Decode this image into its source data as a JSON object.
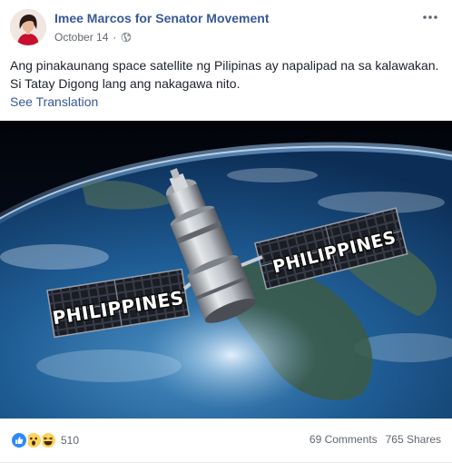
{
  "post": {
    "author": "Imee Marcos for Senator Movement",
    "date": "October 14",
    "separator": "·",
    "audience_icon": "globe-icon",
    "more_icon": "more-options-icon",
    "text_lines": [
      "Ang pinakaunang space satellite ng Pilipinas ay napalipad na sa kalawakan.",
      "Si Tatay Digong lang ang nakagawa nito."
    ],
    "see_translation": "See Translation",
    "image": {
      "label_left": "PHILIPPINES",
      "label_right": "PHILIPPINES"
    }
  },
  "footer": {
    "reaction_icons": [
      "like-icon",
      "wow-icon",
      "haha-icon"
    ],
    "reaction_count": "510",
    "comments": "69 Comments",
    "shares": "765 Shares"
  },
  "colors": {
    "link": "#385898",
    "text": "#1d2129",
    "meta": "#616770",
    "like": "#2d88ff",
    "emoji": "#ffd35a"
  }
}
